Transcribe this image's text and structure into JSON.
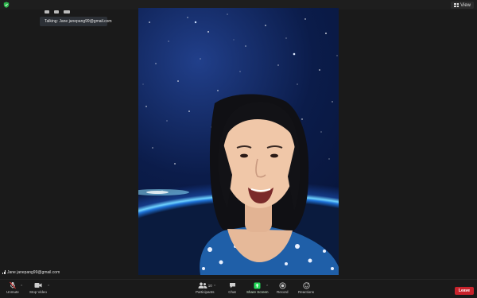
{
  "topbar": {
    "view_label": "View"
  },
  "talking": {
    "text": "Talking: Jane janepang99@gmail.com"
  },
  "participant": {
    "name_tag": "Jane janepang99@gmail.com"
  },
  "toolbar": {
    "unmute": "Unmute",
    "stop_video": "Stop Video",
    "participants": "Participants",
    "participants_count": "10",
    "chat": "Chat",
    "share_screen": "Share Screen",
    "record": "Record",
    "reactions": "Reactions",
    "leave": "Leave"
  },
  "colors": {
    "background": "#1a1a1a",
    "leave": "#c8232c",
    "share_green": "#23d959",
    "shield_green": "#2db84d"
  },
  "icons": [
    "shield-icon",
    "grid-view-icon",
    "microphone-muted-icon",
    "video-camera-icon",
    "participants-icon",
    "chat-icon",
    "share-screen-icon",
    "record-icon",
    "reactions-icon"
  ]
}
